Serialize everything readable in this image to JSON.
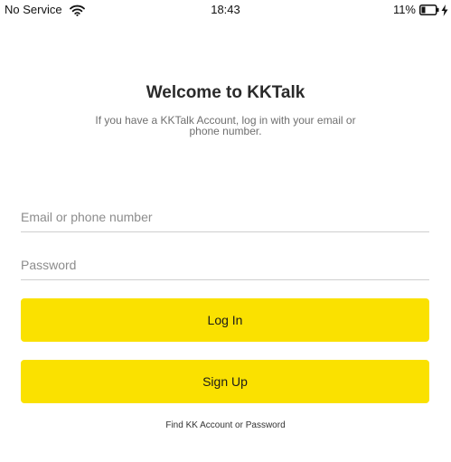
{
  "status_bar": {
    "carrier": "No Service",
    "time": "18:43",
    "battery_percent": "11%",
    "wifi_icon": "wifi-icon",
    "battery_icon": "battery-low-icon",
    "charging_icon": "charging-bolt-icon",
    "battery_level": 0.11
  },
  "header": {
    "title": "Welcome to KKTalk",
    "subtitle": "If you have a KKTalk Account, log in with your email or phone number."
  },
  "form": {
    "email_placeholder": "Email or phone number",
    "email_value": "",
    "password_placeholder": "Password",
    "password_value": "",
    "login_label": "Log In",
    "signup_label": "Sign Up",
    "find_account_label": "Find KK Account or Password"
  },
  "colors": {
    "accent": "#fae100",
    "background": "#ffffff",
    "divider": "#cfcfcf"
  }
}
